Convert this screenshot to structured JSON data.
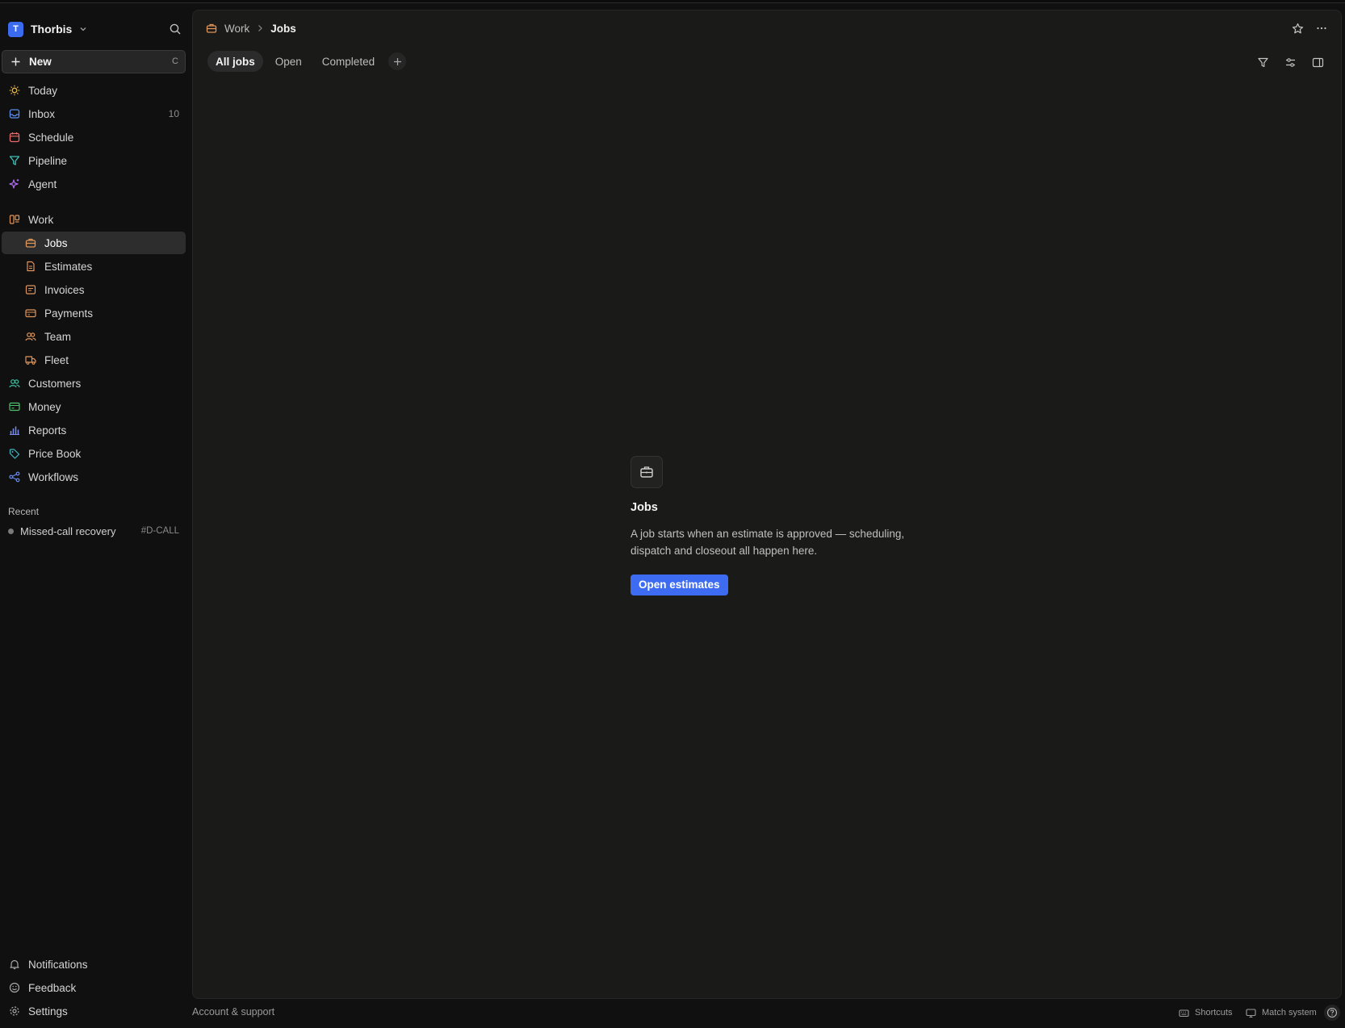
{
  "workspace": {
    "initial": "T",
    "name": "Thorbis"
  },
  "new_button": {
    "label": "New",
    "shortcut": "C"
  },
  "nav": {
    "today": "Today",
    "inbox": "Inbox",
    "inbox_count": "10",
    "schedule": "Schedule",
    "pipeline": "Pipeline",
    "agent": "Agent",
    "work": "Work",
    "jobs": "Jobs",
    "estimates": "Estimates",
    "invoices": "Invoices",
    "payments": "Payments",
    "team": "Team",
    "fleet": "Fleet",
    "customers": "Customers",
    "money": "Money",
    "reports": "Reports",
    "price_book": "Price Book",
    "workflows": "Workflows"
  },
  "recent": {
    "label": "Recent",
    "items": [
      {
        "label": "Missed-call recovery",
        "tag": "#D-CALL"
      }
    ]
  },
  "bottom_nav": {
    "notifications": "Notifications",
    "feedback": "Feedback",
    "settings": "Settings"
  },
  "breadcrumb": {
    "parent": "Work",
    "current": "Jobs"
  },
  "tabs": [
    "All jobs",
    "Open",
    "Completed"
  ],
  "empty_state": {
    "title": "Jobs",
    "description": "A job starts when an estimate is approved — scheduling, dispatch and closeout all happen here.",
    "button": "Open estimates"
  },
  "footer": {
    "left": "Account & support",
    "shortcuts": "Shortcuts",
    "theme": "Match system"
  },
  "colors": {
    "accent": "#3d6cf2",
    "background": "#1a1a19",
    "sidebar": "#101010",
    "work_icon": "#e0955a"
  },
  "icons": {
    "today": "sun-icon",
    "inbox": "inbox-icon",
    "schedule": "calendar-icon",
    "pipeline": "funnel-icon",
    "agent": "sparkle-icon",
    "work": "board-icon",
    "jobs": "briefcase-icon",
    "estimates": "document-icon",
    "invoices": "receipt-icon",
    "payments": "credit-card-icon",
    "team": "people-icon",
    "fleet": "truck-icon",
    "customers": "people-icon",
    "money": "wallet-icon",
    "reports": "bar-chart-icon",
    "price_book": "tag-icon",
    "workflows": "workflow-icon"
  }
}
